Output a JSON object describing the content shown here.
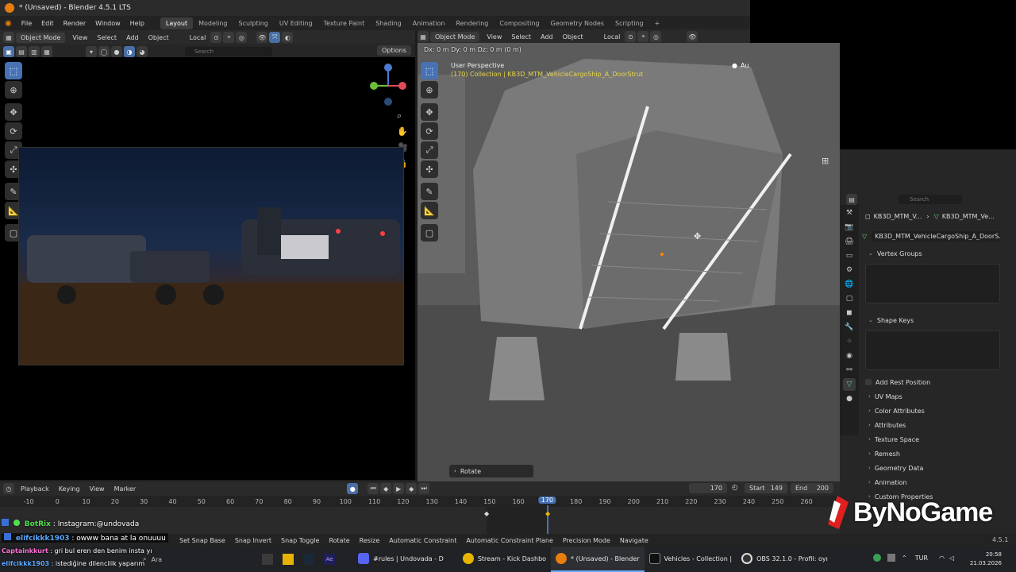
{
  "title_bar": {
    "text": "* (Unsaved) - Blender 4.5.1 LTS"
  },
  "menu": {
    "items": [
      "File",
      "Edit",
      "Render",
      "Window",
      "Help"
    ]
  },
  "workspaces": [
    {
      "label": "Layout",
      "active": true
    },
    {
      "label": "Modeling"
    },
    {
      "label": "Sculpting"
    },
    {
      "label": "UV Editing"
    },
    {
      "label": "Texture Paint"
    },
    {
      "label": "Shading"
    },
    {
      "label": "Animation"
    },
    {
      "label": "Rendering"
    },
    {
      "label": "Compositing"
    },
    {
      "label": "Geometry Nodes"
    },
    {
      "label": "Scripting"
    },
    {
      "label": "+"
    }
  ],
  "left_header": {
    "mode": "Object Mode",
    "view": "View",
    "select": "Select",
    "add": "Add",
    "object": "Object",
    "orientation": "Local",
    "search_placeholder": "Search",
    "options": "Options"
  },
  "right_header": {
    "mode": "Object Mode",
    "view": "View",
    "select": "Select",
    "add": "Add",
    "object": "Object",
    "orientation": "Local"
  },
  "right_view": {
    "delta_readout": "Dx: 0 m   Dy: 0 m   Dz: 0 m (0 m)",
    "perspective": "User Perspective",
    "collection": "(170) Collection | KB3D_MTM_VehicleCargoShip_A_DoorStrut",
    "rotate_label": "Rotate",
    "corner_label": "Au"
  },
  "properties": {
    "search_placeholder": "Search",
    "breadcrumb": [
      "KB3D_MTM_V...",
      "KB3D_MTM_Ve..."
    ],
    "object_name": "KB3D_MTM_VehicleCargoShip_A_DoorS...",
    "panels": {
      "vertex_groups": "Vertex Groups",
      "shape_keys": "Shape Keys",
      "add_rest_position": "Add Rest Position",
      "uv_maps": "UV Maps",
      "color_attributes": "Color Attributes",
      "attributes": "Attributes",
      "texture_space": "Texture Space",
      "remesh": "Remesh",
      "geometry_data": "Geometry Data",
      "animation": "Animation",
      "custom_properties": "Custom Properties"
    }
  },
  "timeline": {
    "menus": [
      "Playback",
      "Keying",
      "View",
      "Marker"
    ],
    "current_frame": "170",
    "start_label": "Start",
    "start": "149",
    "end_label": "End",
    "end": "200",
    "ticks": [
      "-10",
      "0",
      "10",
      "20",
      "30",
      "40",
      "50",
      "60",
      "70",
      "80",
      "90",
      "100",
      "110",
      "120",
      "130",
      "140",
      "150",
      "160",
      "170",
      "180",
      "190",
      "200",
      "210",
      "220",
      "230",
      "240",
      "250",
      "260"
    ],
    "current_tick": "170"
  },
  "status_bar": {
    "items": [
      "Set Snap Base",
      "Snap Invert",
      "Snap Toggle",
      "Rotate",
      "Resize",
      "Automatic Constraint",
      "Automatic Constraint Plane",
      "Precision Mode",
      "Navigate"
    ],
    "version": "4.5.1"
  },
  "chat": [
    {
      "user": "BotRix",
      "text": ": Instagram:@undovada",
      "color": "#4fe04f"
    },
    {
      "user": "elifcikkk1903",
      "text": ": owww bana at la onuuuu",
      "color": "#5aa8ff"
    },
    {
      "user": "Captainkkurt",
      "text": ": gri bul eren den benim insta yı",
      "color": "#ff6fd8"
    },
    {
      "user": "elifcikkk1903",
      "text": ": istediğine dilencilik yaparım",
      "color": "#5aa8ff"
    }
  ],
  "watermark": "ByNoGame",
  "taskbar": {
    "search_label": "Ara",
    "apps": [
      {
        "label": "#rules | Undovada - D",
        "color": "#5865f2"
      },
      {
        "label": "Stream - Kick Dashbo",
        "color": "#e8b400"
      },
      {
        "label": "* (Unsaved) - Blender",
        "color": "#e87d0d",
        "active": true
      },
      {
        "label": "Vehicles - Collection |",
        "color": "#111111"
      },
      {
        "label": "OBS 32.1.0 - Profil: oyı",
        "color": "#333333"
      }
    ],
    "lang": "TUR",
    "time": "20:58",
    "date": "21.03.2026"
  },
  "colors": {
    "accent": "#4772b3",
    "blender_orange": "#e87d0d",
    "active_frame": "#4772b3"
  }
}
